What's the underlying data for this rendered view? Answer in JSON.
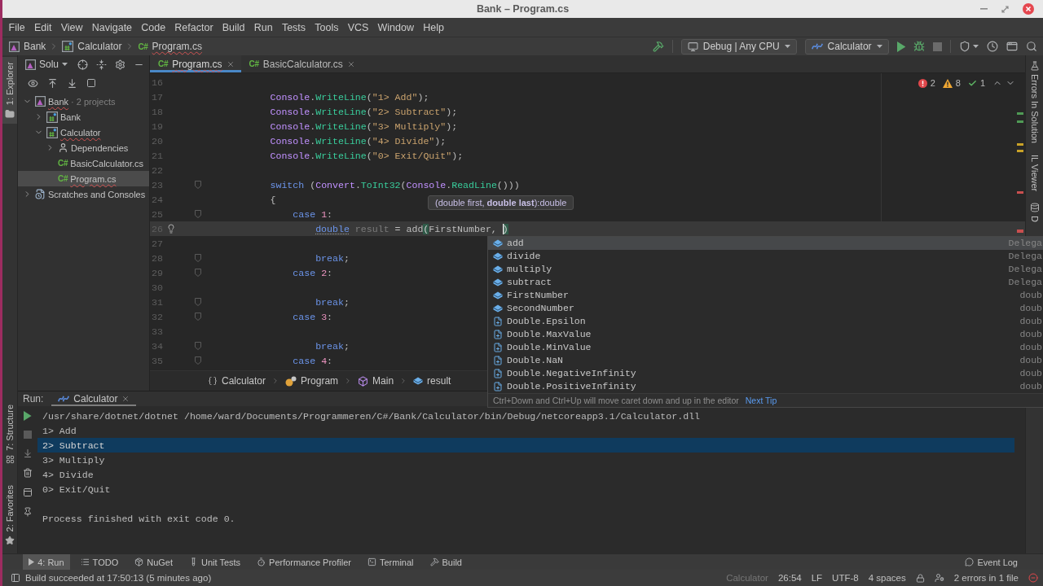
{
  "window": {
    "title": "Bank – Program.cs"
  },
  "menu": [
    "File",
    "Edit",
    "View",
    "Navigate",
    "Code",
    "Refactor",
    "Build",
    "Run",
    "Tests",
    "Tools",
    "VCS",
    "Window",
    "Help"
  ],
  "breadcrumbs": [
    {
      "label": "Bank",
      "kind": "solution",
      "error": false
    },
    {
      "label": "Calculator",
      "kind": "project",
      "error": false
    },
    {
      "label": "Program.cs",
      "kind": "file",
      "icon_text": "C#",
      "error": true
    }
  ],
  "toolbar": {
    "configuration": "Debug | Any CPU",
    "run_target": "Calculator"
  },
  "left_stripe": {
    "top": [
      {
        "label": "1: Explorer",
        "kind": "explorer",
        "selected": true
      }
    ],
    "bottom": [
      {
        "label": "7: Structure",
        "kind": "structure",
        "selected": false
      },
      {
        "label": "2: Favorites",
        "kind": "favorites",
        "selected": false
      }
    ]
  },
  "solution_panel": {
    "title": "Solu",
    "tree": [
      {
        "label": "Bank",
        "note": "· 2 projects",
        "kind": "solution",
        "expanded": true,
        "selected": false,
        "error": true,
        "children": [
          {
            "label": "Bank",
            "kind": "project",
            "expanded": false,
            "selected": false,
            "error": false
          },
          {
            "label": "Calculator",
            "kind": "project",
            "expanded": true,
            "selected": false,
            "error": true,
            "children": [
              {
                "label": "Dependencies",
                "kind": "dependencies",
                "expanded": false,
                "selected": false,
                "error": false
              },
              {
                "label": "BasicCalculator.cs",
                "kind": "file",
                "icon_text": "C#",
                "selected": false,
                "error": false
              },
              {
                "label": "Program.cs",
                "kind": "file",
                "icon_text": "C#",
                "selected": true,
                "error": true
              }
            ]
          }
        ]
      },
      {
        "label": "Scratches and Consoles",
        "kind": "scratches",
        "expanded": false,
        "selected": false,
        "error": false
      }
    ]
  },
  "tabs": [
    {
      "label": "Program.cs",
      "icon_text": "C#",
      "selected": true,
      "error": true
    },
    {
      "label": "BasicCalculator.cs",
      "icon_text": "C#",
      "selected": false,
      "error": false
    }
  ],
  "editor": {
    "inspections": {
      "errors": "2",
      "warnings": "8",
      "passed": "1"
    },
    "lines": [
      {
        "number": "16",
        "kind": "plain",
        "current": false
      },
      {
        "number": "17",
        "kind": "plain",
        "current": false,
        "code": [
          {
            "kind": "type",
            "text": "            Console"
          },
          {
            "kind": "plain",
            "text": "."
          },
          {
            "kind": "method",
            "text": "WriteLine"
          },
          {
            "kind": "plain",
            "text": "("
          },
          {
            "kind": "string",
            "text": "\"1> Add\""
          },
          {
            "kind": "plain",
            "text": ");"
          }
        ]
      },
      {
        "number": "18",
        "kind": "plain",
        "current": false,
        "code": [
          {
            "kind": "type",
            "text": "            Console"
          },
          {
            "kind": "plain",
            "text": "."
          },
          {
            "kind": "method",
            "text": "WriteLine"
          },
          {
            "kind": "plain",
            "text": "("
          },
          {
            "kind": "string",
            "text": "\"2> Subtract\""
          },
          {
            "kind": "plain",
            "text": ");"
          }
        ]
      },
      {
        "number": "19",
        "kind": "plain",
        "current": false,
        "code": [
          {
            "kind": "type",
            "text": "            Console"
          },
          {
            "kind": "plain",
            "text": "."
          },
          {
            "kind": "method",
            "text": "WriteLine"
          },
          {
            "kind": "plain",
            "text": "("
          },
          {
            "kind": "string",
            "text": "\"3> Multiply\""
          },
          {
            "kind": "plain",
            "text": ");"
          }
        ]
      },
      {
        "number": "20",
        "kind": "plain",
        "current": false,
        "code": [
          {
            "kind": "type",
            "text": "            Console"
          },
          {
            "kind": "plain",
            "text": "."
          },
          {
            "kind": "method",
            "text": "WriteLine"
          },
          {
            "kind": "plain",
            "text": "("
          },
          {
            "kind": "string",
            "text": "\"4> Divide\""
          },
          {
            "kind": "plain",
            "text": ");"
          }
        ]
      },
      {
        "number": "21",
        "kind": "plain",
        "current": false,
        "code": [
          {
            "kind": "type",
            "text": "            Console"
          },
          {
            "kind": "plain",
            "text": "."
          },
          {
            "kind": "method",
            "text": "WriteLine"
          },
          {
            "kind": "plain",
            "text": "("
          },
          {
            "kind": "string",
            "text": "\"0> Exit/Quit\""
          },
          {
            "kind": "plain",
            "text": ");"
          }
        ]
      },
      {
        "number": "22",
        "kind": "plain",
        "current": false
      },
      {
        "number": "23",
        "kind": "fold",
        "current": false,
        "code": [
          {
            "kind": "keyword",
            "text": "            switch"
          },
          {
            "kind": "plain",
            "text": " ("
          },
          {
            "kind": "type",
            "text": "Convert"
          },
          {
            "kind": "plain",
            "text": "."
          },
          {
            "kind": "method",
            "text": "ToInt32"
          },
          {
            "kind": "plain",
            "text": "("
          },
          {
            "kind": "type",
            "text": "Console"
          },
          {
            "kind": "plain",
            "text": "."
          },
          {
            "kind": "method",
            "text": "ReadLine"
          },
          {
            "kind": "plain",
            "text": "()))"
          }
        ]
      },
      {
        "number": "24",
        "kind": "plain",
        "current": false,
        "code": [
          {
            "kind": "plain",
            "text": "            {"
          }
        ]
      },
      {
        "number": "25",
        "kind": "fold",
        "current": false,
        "code": [
          {
            "kind": "keyword",
            "text": "                case "
          },
          {
            "kind": "number",
            "text": "1"
          },
          {
            "kind": "plain",
            "text": ":"
          }
        ]
      },
      {
        "number": "26",
        "kind": "bulb",
        "current": true,
        "code": [
          {
            "kind": "keyword_hint",
            "text": "                    double"
          },
          {
            "kind": "unused",
            "text": " result"
          },
          {
            "kind": "plain",
            "text": " = add"
          },
          {
            "kind": "brace",
            "text": "("
          },
          {
            "kind": "plain",
            "text": "FirstNumber, "
          },
          {
            "kind": "caret_brace",
            "text": ")"
          }
        ]
      },
      {
        "number": "27",
        "kind": "plain",
        "current": false
      },
      {
        "number": "28",
        "kind": "fold",
        "current": false,
        "code": [
          {
            "kind": "keyword",
            "text": "                    break"
          },
          {
            "kind": "plain",
            "text": ";"
          }
        ]
      },
      {
        "number": "29",
        "kind": "fold",
        "current": false,
        "code": [
          {
            "kind": "keyword",
            "text": "                case "
          },
          {
            "kind": "number",
            "text": "2"
          },
          {
            "kind": "plain",
            "text": ":"
          }
        ]
      },
      {
        "number": "30",
        "kind": "plain",
        "current": false
      },
      {
        "number": "31",
        "kind": "fold",
        "current": false,
        "code": [
          {
            "kind": "keyword",
            "text": "                    break"
          },
          {
            "kind": "plain",
            "text": ";"
          }
        ]
      },
      {
        "number": "32",
        "kind": "fold",
        "current": false,
        "code": [
          {
            "kind": "keyword",
            "text": "                case "
          },
          {
            "kind": "number",
            "text": "3"
          },
          {
            "kind": "plain",
            "text": ":"
          }
        ]
      },
      {
        "number": "33",
        "kind": "plain",
        "current": false
      },
      {
        "number": "34",
        "kind": "fold",
        "current": false,
        "code": [
          {
            "kind": "keyword",
            "text": "                    break"
          },
          {
            "kind": "plain",
            "text": ";"
          }
        ]
      },
      {
        "number": "35",
        "kind": "fold",
        "current": false,
        "code": [
          {
            "kind": "keyword",
            "text": "                case "
          },
          {
            "kind": "number",
            "text": "4"
          },
          {
            "kind": "plain",
            "text": ":"
          }
        ]
      }
    ],
    "breadcrumb": [
      {
        "label": "Calculator",
        "kind": "namespace"
      },
      {
        "label": "Program",
        "kind": "class"
      },
      {
        "label": "Main",
        "kind": "method"
      },
      {
        "label": "result",
        "kind": "variable"
      }
    ]
  },
  "parameter_info": "(double first, **double last**):double",
  "completion": {
    "items": [
      {
        "label": "add",
        "type": "Delega",
        "kind": "field",
        "selected": true
      },
      {
        "label": "divide",
        "type": "Delega",
        "kind": "field",
        "selected": false
      },
      {
        "label": "multiply",
        "type": "Delega",
        "kind": "field",
        "selected": false
      },
      {
        "label": "subtract",
        "type": "Delega",
        "kind": "field",
        "selected": false
      },
      {
        "label": "FirstNumber",
        "type": "doub",
        "kind": "field",
        "selected": false
      },
      {
        "label": "SecondNumber",
        "type": "doub",
        "kind": "field",
        "selected": false
      },
      {
        "label": "Double.Epsilon",
        "type": "doub",
        "kind": "constant",
        "selected": false
      },
      {
        "label": "Double.MaxValue",
        "type": "doub",
        "kind": "constant",
        "selected": false
      },
      {
        "label": "Double.MinValue",
        "type": "doub",
        "kind": "constant",
        "selected": false
      },
      {
        "label": "Double.NaN",
        "type": "doub",
        "kind": "constant",
        "selected": false
      },
      {
        "label": "Double.NegativeInfinity",
        "type": "doub",
        "kind": "constant",
        "selected": false
      },
      {
        "label": "Double.PositiveInfinity",
        "type": "doub",
        "kind": "constant",
        "selected": false
      }
    ],
    "hint": "Ctrl+Down and Ctrl+Up will move caret down and up in the editor",
    "link": "Next Tip"
  },
  "right_stripe": [
    {
      "label": "Errors In Solution",
      "kind": "errors"
    },
    {
      "label": "IL Viewer",
      "kind": "il"
    },
    {
      "label": "D",
      "kind": "database"
    }
  ],
  "run_panel": {
    "label": "Run:",
    "tab": "Calculator",
    "output": [
      {
        "text": "/usr/share/dotnet/dotnet /home/ward/Documents/Programmeren/C#/Bank/Calculator/bin/Debug/netcoreapp3.1/Calculator.dll",
        "selected": false
      },
      {
        "text": "1> Add",
        "selected": false
      },
      {
        "text": "2> Subtract",
        "selected": true
      },
      {
        "text": "3> Multiply",
        "selected": false
      },
      {
        "text": "4> Divide",
        "selected": false
      },
      {
        "text": "0> Exit/Quit",
        "selected": false
      }
    ],
    "exit_message": "Process finished with exit code 0."
  },
  "tool_windows": [
    {
      "label": "4: Run",
      "kind": "run",
      "selected": true
    },
    {
      "label": "TODO",
      "kind": "todo",
      "selected": false
    },
    {
      "label": "NuGet",
      "kind": "nuget",
      "selected": false
    },
    {
      "label": "Unit Tests",
      "kind": "tests",
      "selected": false
    },
    {
      "label": "Performance Profiler",
      "kind": "profiler",
      "selected": false
    },
    {
      "label": "Terminal",
      "kind": "terminal",
      "selected": false
    },
    {
      "label": "Build",
      "kind": "build",
      "selected": false
    }
  ],
  "event_log": "Event Log",
  "status_bar": {
    "message": "Build succeeded at 17:50:13 (5 minutes ago)",
    "context": "Calculator",
    "position": "26:54",
    "line_ending": "LF",
    "encoding": "UTF-8",
    "indent": "4 spaces",
    "problems": "2 errors in 1 file"
  }
}
